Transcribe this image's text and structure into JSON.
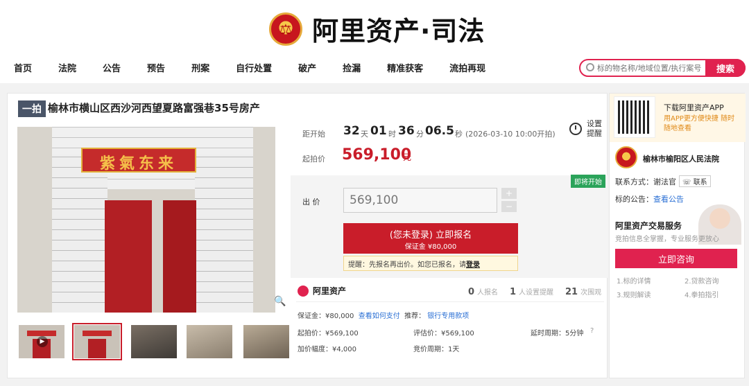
{
  "header": {
    "logo_text": "阿里资产·司法",
    "nav": [
      "首页",
      "法院",
      "公告",
      "预告",
      "刑案",
      "自行处置",
      "破产",
      "捡漏",
      "精准获客",
      "流拍再现"
    ],
    "search_placeholder": "标的物名称/地域位置/执行案号",
    "search_button": "搜索"
  },
  "listing": {
    "tag": "一拍",
    "title": "榆林市横山区西沙河西望夏路富强巷35号房产",
    "photo_banner_text": "紫氣东来",
    "countdown": {
      "label": "距开始",
      "days": "32",
      "days_unit": "天",
      "hours": "01",
      "hours_unit": "时",
      "minutes": "36",
      "minutes_unit": "分",
      "seconds": "06.5",
      "seconds_unit": "秒",
      "start_note": "(2026-03-10 10:00开拍)"
    },
    "reminder_label": "设置提醒",
    "start_price_label": "起拍价",
    "start_price": "569,100",
    "price_unit": "元",
    "status_badge": "即将开始",
    "bid_label": "出  价",
    "bid_value": "569,100",
    "plus": "+",
    "minus": "−",
    "signup_line1": "(您未登录) 立即报名",
    "signup_line2": "保证金 ¥80,000",
    "tip_text": "提醒：先报名再出价。如您已报名，请",
    "tip_link": "登录",
    "platform": "阿里资产",
    "stats": [
      {
        "num": "0",
        "label": "人报名"
      },
      {
        "num": "1",
        "label": "人设置提醒"
      },
      {
        "num": "21",
        "label": "次围观"
      }
    ],
    "details": {
      "deposit": "保证金：¥80,000",
      "deposit_link": "查看如何支付",
      "recommend_label": "推荐：",
      "recommend_link": "银行专用款项",
      "start_price": "起拍价：¥569,100",
      "appraisal": "评估价：¥569,100",
      "delay": "延时周期：5分钟",
      "increment": "加价幅度：¥4,000",
      "cycle": "竞价周期：1天"
    }
  },
  "sidebar": {
    "app_title": "下载阿里资产APP",
    "app_sub": "用APP更方便快捷 随时随地查看",
    "court_name": "榆林市榆阳区人民法院",
    "contact_label": "联系方式：谢法官",
    "contact_button": "联系",
    "notice_label": "标的公告：",
    "notice_link": "查看公告",
    "service_title": "阿里资产交易服务",
    "service_sub": "竞拍信息全掌握，专业服务更放心",
    "consult_button": "立即咨询",
    "links": [
      "1.标的详情",
      "2.贷款咨询",
      "3.规则解读",
      "4.拳拍指引"
    ]
  }
}
